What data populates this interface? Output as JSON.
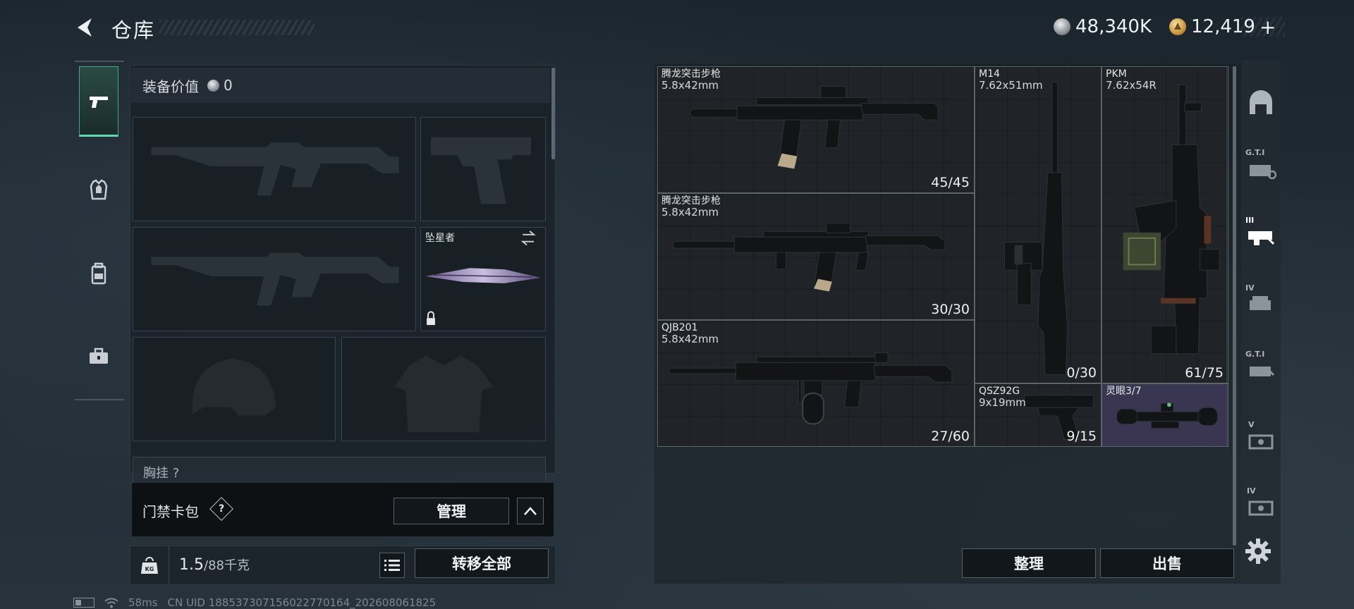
{
  "header": {
    "title": "仓库",
    "currencies": [
      {
        "icon": "silver-coin-icon",
        "value": "48,340K"
      },
      {
        "icon": "gold-coin-icon",
        "value": "12,419"
      }
    ],
    "add_currency_label": "+"
  },
  "equipment": {
    "value_label": "装备价值",
    "value": "0",
    "melee_name": "坠星者",
    "chest_label": "胸挂 ?"
  },
  "keycard": {
    "label": "门禁卡包",
    "help": "?",
    "manage_label": "管理"
  },
  "weight": {
    "current": "1.5",
    "capacity": "/88千克",
    "transfer_label": "转移全部"
  },
  "status": {
    "ping": "58ms",
    "uid": "CN UID 18853730715602277016​4_202608061825"
  },
  "stash": {
    "items": [
      {
        "name": "腾龙突击步枪",
        "caliber": "5.8x42mm",
        "count": "45/45"
      },
      {
        "name": "腾龙突击步枪",
        "caliber": "5.8x42mm",
        "count": "30/30"
      },
      {
        "name": "QJB201",
        "caliber": "5.8x42mm",
        "count": "27/60"
      },
      {
        "name": "M14",
        "caliber": "7.62x51mm",
        "count": "0/30"
      },
      {
        "name": "PKM",
        "caliber": "7.62x54R",
        "count": "61/75"
      },
      {
        "name": "QSZ92G",
        "caliber": "9x19mm",
        "count": "9/15"
      },
      {
        "name": "灵眼3/7",
        "caliber": "",
        "count": ""
      }
    ],
    "sort_label": "整理",
    "sell_label": "出售"
  },
  "rail": {
    "labels": [
      "G.T.I",
      "III",
      "IV",
      "G.T.I",
      "V",
      "IV"
    ]
  },
  "colors": {
    "accent": "#5fd9b5",
    "scope_bg": "#3e3a58",
    "panel": "#171f26"
  }
}
